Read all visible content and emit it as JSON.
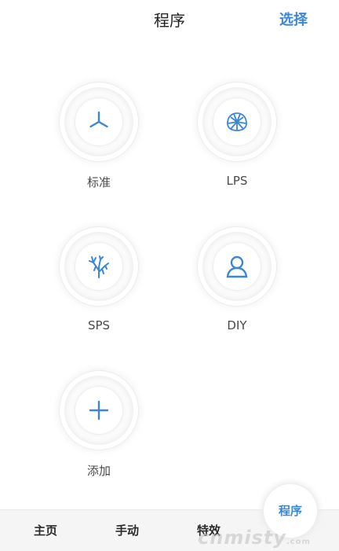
{
  "header": {
    "title": "程序",
    "select_label": "选择"
  },
  "programs": [
    {
      "label": "标准",
      "icon": "fan-icon"
    },
    {
      "label": "LPS",
      "icon": "coral-lps-icon"
    },
    {
      "label": "SPS",
      "icon": "coral-sps-icon"
    },
    {
      "label": "DIY",
      "icon": "user-icon"
    },
    {
      "label": "添加",
      "icon": "plus-icon"
    }
  ],
  "tabs": [
    {
      "label": "主页"
    },
    {
      "label": "手动"
    },
    {
      "label": "特效"
    }
  ],
  "fab": {
    "label": "程序"
  },
  "watermark": {
    "text": "cnmisty",
    "suffix": ".com"
  },
  "colors": {
    "accent": "#3c86d6",
    "text": "#222222",
    "tabbar_bg": "#f5f5f5"
  }
}
